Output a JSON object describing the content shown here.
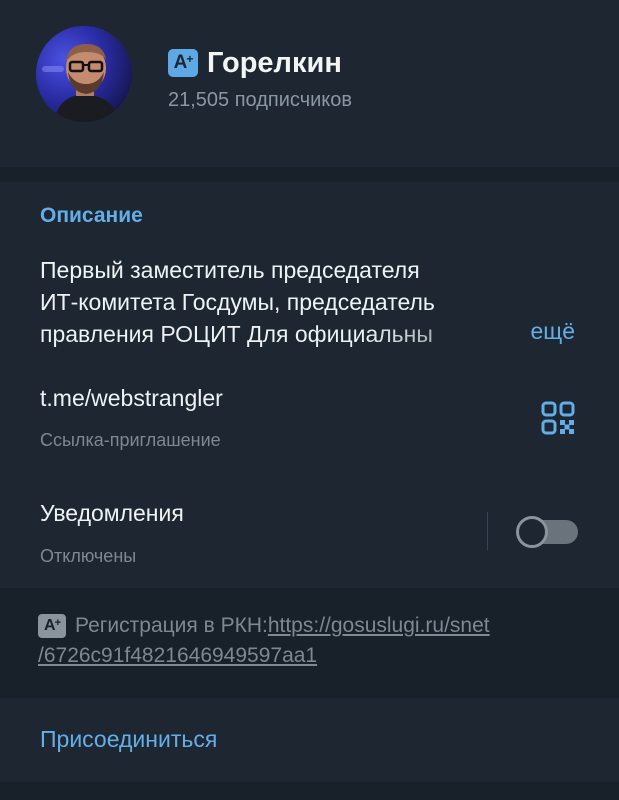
{
  "channel": {
    "name": "Горелкин",
    "badge": "A+",
    "subscribers": "21,505 подписчиков"
  },
  "info": {
    "description_title": "Описание",
    "description_lines": [
      "Первый заместитель председателя",
      "ИТ-комитета Госдумы, председатель",
      "правления РОЦИТ  Для официальны"
    ],
    "more_label": "ещё",
    "link_value": "t.me/webstrangler",
    "link_label": "Ссылка-приглашение",
    "notifications_label": "Уведомления",
    "notifications_status": "Отключены",
    "notifications_enabled": false
  },
  "registration": {
    "badge": "A+",
    "prefix": "Регистрация в РКН: ",
    "url_part1": "https://gosuslugi.ru/snet",
    "url_part2": "/6726c91f4821646949597aa1"
  },
  "join": {
    "label": "Присоединиться"
  },
  "icons": {
    "qr": "qr-code-icon",
    "toggle": "toggle-switch"
  },
  "colors": {
    "accent": "#63aee8",
    "background": "#182029",
    "panel": "#1e2731",
    "text": "#f0f2f5",
    "secondary": "#7d8893"
  }
}
